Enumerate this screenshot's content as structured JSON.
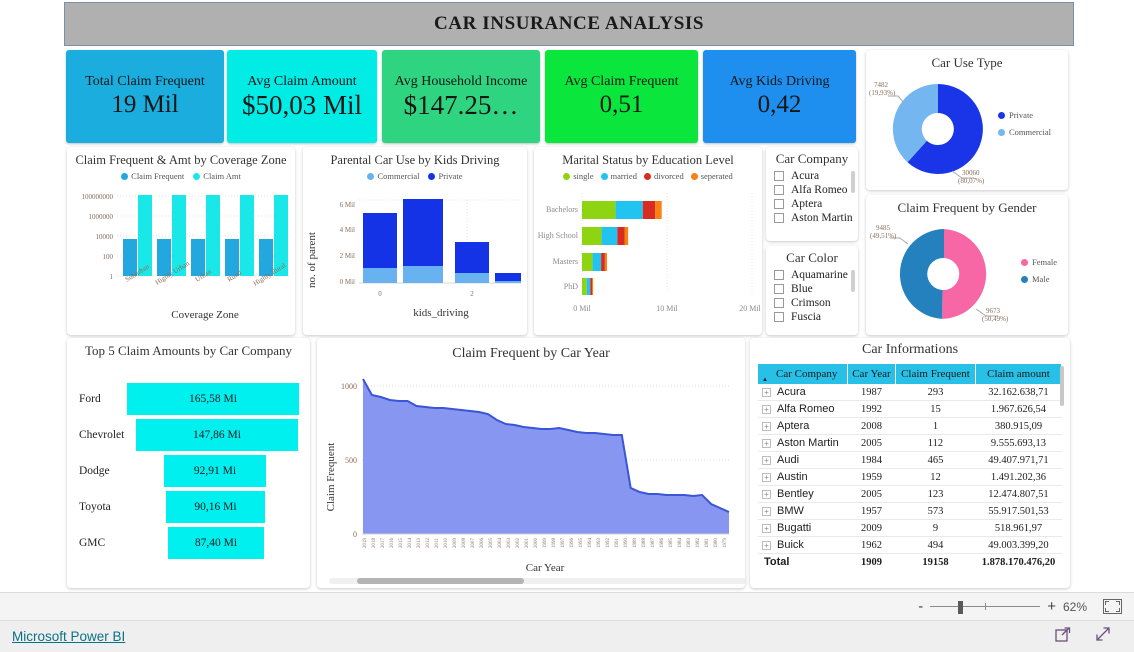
{
  "report": {
    "title": "CAR INSURANCE ANALYSIS",
    "banner_color": "#b0b0b0"
  },
  "kpis": [
    {
      "label": "Total Claim Frequent",
      "value": "19 Mil",
      "color": "#1aadde"
    },
    {
      "label": "Avg Claim Amount",
      "value": "$50,03 Mil",
      "color": "#00ece5"
    },
    {
      "label": "Avg Household Income",
      "value": "$147.25…",
      "color": "#2ed47f"
    },
    {
      "label": "Avg Claim Frequent",
      "value": "0,51",
      "color": "#0ae63c"
    },
    {
      "label": "Avg Kids Driving",
      "value": "0,42",
      "color": "#1e8fef"
    }
  ],
  "car_use_type": {
    "title": "Car Use Type",
    "chart_data": {
      "type": "pie",
      "title": "Car Use Type",
      "labels": [
        "Private",
        "Commercial"
      ],
      "values": [
        30060,
        7482
      ],
      "percents": [
        "80,07%",
        "19,93%"
      ],
      "colors": [
        "#1a35e8",
        "#74b6ef"
      ],
      "callouts": [
        {
          "label": "30060",
          "percent": "(80,07%)"
        },
        {
          "label": "7482",
          "percent": "(19,93%)"
        }
      ],
      "legend_position": "right"
    }
  },
  "gender_donut": {
    "title": "Claim Frequent by Gender",
    "chart_data": {
      "type": "pie",
      "title": "Claim Frequent by Gender",
      "labels": [
        "Female",
        "Male"
      ],
      "values": [
        9673,
        9485
      ],
      "percents": [
        "50,49%",
        "49,51%"
      ],
      "colors": [
        "#f767a6",
        "#2481bd"
      ],
      "callouts": [
        {
          "label": "9673",
          "percent": "(50,49%)"
        },
        {
          "label": "9485",
          "percent": "(49,51%)"
        }
      ],
      "legend_position": "right"
    }
  },
  "coverage_zone": {
    "chart_data": {
      "type": "bar",
      "title": "Claim Frequent & Amt by Coverage Zone",
      "xlabel": "Coverage Zone",
      "ylabel": "",
      "yscale": "log",
      "yticks": [
        "1",
        "100",
        "10000",
        "1000000",
        "100000000"
      ],
      "categories": [
        "Suburban",
        "Highly Urban",
        "Urban",
        "Rural",
        "Highly Rural"
      ],
      "series": [
        {
          "name": "Claim Frequent",
          "color": "#22a8df",
          "values": [
            4200,
            4300,
            4100,
            4000,
            4100
          ]
        },
        {
          "name": "Claim Amt",
          "color": "#1ae8e8",
          "values": [
            380000000,
            390000000,
            375000000,
            360000000,
            370000000
          ]
        }
      ],
      "legend_position": "top",
      "grid": true
    }
  },
  "parental_car_use": {
    "chart_data": {
      "type": "bar",
      "stacked": true,
      "title": "Parental Car Use by Kids Driving",
      "xlabel": "kids_driving",
      "ylabel": "no. of parent",
      "categories": [
        "0",
        "1",
        "2",
        "3"
      ],
      "xticks": [
        "0",
        "2"
      ],
      "yticks": [
        "0 Mil",
        "2 Mil",
        "4 Mil",
        "6 Mil"
      ],
      "ylim": [
        0,
        7
      ],
      "series": [
        {
          "name": "Commercial",
          "color": "#68b2f2",
          "values": [
            1.25,
            1.45,
            0.8,
            0.15
          ]
        },
        {
          "name": "Private",
          "color": "#1433e6",
          "values": [
            4.55,
            5.55,
            2.55,
            0.7
          ]
        }
      ],
      "legend_position": "top",
      "grid": true
    }
  },
  "marital_status": {
    "chart_data": {
      "type": "bar",
      "stacked": true,
      "orientation": "horizontal",
      "title": "Marital Status by Education Level",
      "xlabel": "",
      "ylabel": "",
      "categories": [
        "Bachelors",
        "High School",
        "Masters",
        "PhD"
      ],
      "xticks": [
        "0 Mil",
        "10 Mil",
        "20 Mil"
      ],
      "xlim": [
        0,
        20
      ],
      "series": [
        {
          "name": "single",
          "color": "#8ed412",
          "values": [
            3.95,
            2.3,
            1.25,
            0.55
          ]
        },
        {
          "name": "married",
          "color": "#21c3f0",
          "values": [
            3.2,
            1.85,
            1.0,
            0.42
          ]
        },
        {
          "name": "divorced",
          "color": "#d92b22",
          "values": [
            1.45,
            0.85,
            0.45,
            0.2
          ]
        },
        {
          "name": "seperated",
          "color": "#f98012",
          "values": [
            0.78,
            0.42,
            0.24,
            0.12
          ]
        }
      ],
      "legend_position": "top",
      "grid": true
    }
  },
  "slicer_company": {
    "title": "Car Company",
    "items": [
      {
        "label": "Acura",
        "checked": false
      },
      {
        "label": "Alfa Romeo",
        "checked": false
      },
      {
        "label": "Aptera",
        "checked": false
      },
      {
        "label": "Aston Martin",
        "checked": false
      }
    ]
  },
  "slicer_color": {
    "title": "Car Color",
    "items": [
      {
        "label": "Aquamarine",
        "checked": false
      },
      {
        "label": "Blue",
        "checked": false
      },
      {
        "label": "Crimson",
        "checked": false
      },
      {
        "label": "Fuscia",
        "checked": false
      }
    ]
  },
  "top5_funnel": {
    "chart_data": {
      "type": "bar",
      "title": "Top 5 Claim Amounts by Car Company",
      "categories": [
        "Ford",
        "Chevrolet",
        "Dodge",
        "Toyota",
        "GMC"
      ],
      "values": [
        165.58,
        147.86,
        92.91,
        90.16,
        87.4
      ],
      "labels": [
        "165,58 Mi",
        "147,86 Mi",
        "92,91 Mi",
        "90,16 Mi",
        "87,40 Mi"
      ],
      "color": "#00efef",
      "xlabel": "",
      "ylabel": ""
    }
  },
  "claim_by_year": {
    "chart_data": {
      "type": "area",
      "title": "Claim Frequent by Car Year",
      "xlabel": "Car Year",
      "ylabel": "Claim Frequent",
      "yticks": [
        "0",
        "500",
        "1000"
      ],
      "ylim": [
        0,
        1100
      ],
      "fill_color": "#8796f0",
      "line_color": "#3a55d6",
      "values": [
        1045,
        940,
        925,
        905,
        900,
        895,
        862,
        855,
        850,
        845,
        840,
        835,
        828,
        822,
        810,
        770,
        745,
        735,
        722,
        712,
        710,
        708,
        712,
        705,
        690,
        680,
        678,
        672,
        668,
        665,
        310,
        285,
        270,
        268,
        265,
        262,
        260,
        258,
        262,
        200,
        175,
        152
      ],
      "grid": true
    }
  },
  "car_info_table": {
    "title": "Car Informations",
    "columns": [
      "Car Company",
      "Car Year",
      "Claim Frequent",
      "Claim amount"
    ],
    "rows": [
      {
        "company": "Acura",
        "year": "1987",
        "freq": "293",
        "amount": "32.162.638,71"
      },
      {
        "company": "Alfa Romeo",
        "year": "1992",
        "freq": "15",
        "amount": "1.967.626,54"
      },
      {
        "company": "Aptera",
        "year": "2008",
        "freq": "1",
        "amount": "380.915,09"
      },
      {
        "company": "Aston Martin",
        "year": "2005",
        "freq": "112",
        "amount": "9.555.693,13"
      },
      {
        "company": "Audi",
        "year": "1984",
        "freq": "465",
        "amount": "49.407.971,71"
      },
      {
        "company": "Austin",
        "year": "1959",
        "freq": "12",
        "amount": "1.491.202,36"
      },
      {
        "company": "Bentley",
        "year": "2005",
        "freq": "123",
        "amount": "12.474.807,51"
      },
      {
        "company": "BMW",
        "year": "1957",
        "freq": "573",
        "amount": "55.917.501,53"
      },
      {
        "company": "Bugatti",
        "year": "2009",
        "freq": "9",
        "amount": "518.961,97"
      },
      {
        "company": "Buick",
        "year": "1962",
        "freq": "494",
        "amount": "49.003.399,20"
      }
    ],
    "total": {
      "company": "Total",
      "year": "1909",
      "freq": "19158",
      "amount": "1.878.170.476,20"
    }
  },
  "statusbar": {
    "zoom_percent": "62%",
    "minus": "-",
    "plus": "+"
  },
  "footer": {
    "link": "Microsoft Power BI"
  }
}
